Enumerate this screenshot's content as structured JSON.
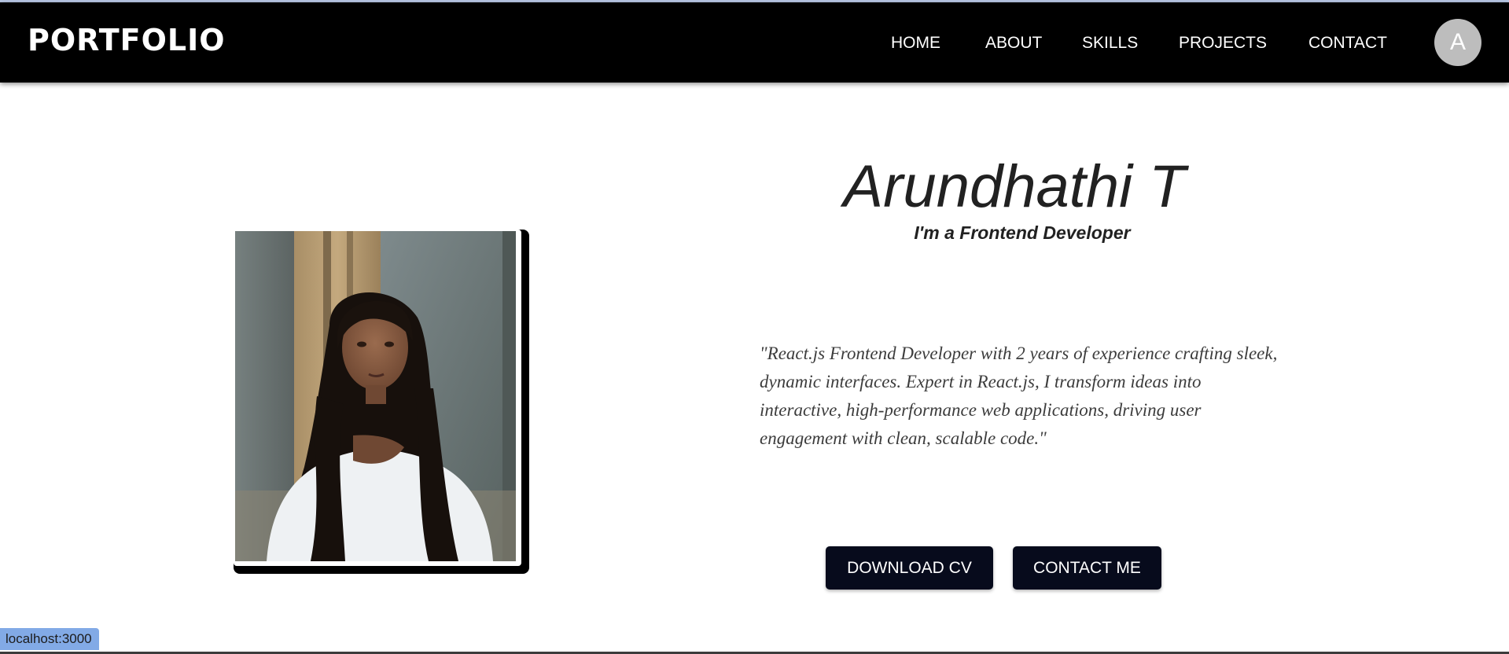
{
  "brand": "PORTFOLIO",
  "nav": {
    "home": "HOME",
    "about": "ABOUT",
    "skills": "SKILLS",
    "projects": "PROJECTS",
    "contact": "CONTACT"
  },
  "avatar": {
    "initial": "A"
  },
  "hero": {
    "name": "Arundhathi T",
    "role": "I'm a Frontend Developer",
    "quote": "\"React.js Frontend Developer with 2 years of experience crafting sleek, dynamic interfaces. Expert in React.js, I transform ideas into interactive, high-performance web applications, driving user engagement with clean, scalable code.\"",
    "download_cv_label": "DOWNLOAD CV",
    "contact_me_label": "CONTACT ME"
  },
  "status_bar": {
    "url": "localhost:3000"
  },
  "colors": {
    "navbar_bg": "#000000",
    "button_bg": "#070b1c",
    "avatar_bg": "#bdbdbd",
    "status_bar_bg": "#82aae6"
  }
}
